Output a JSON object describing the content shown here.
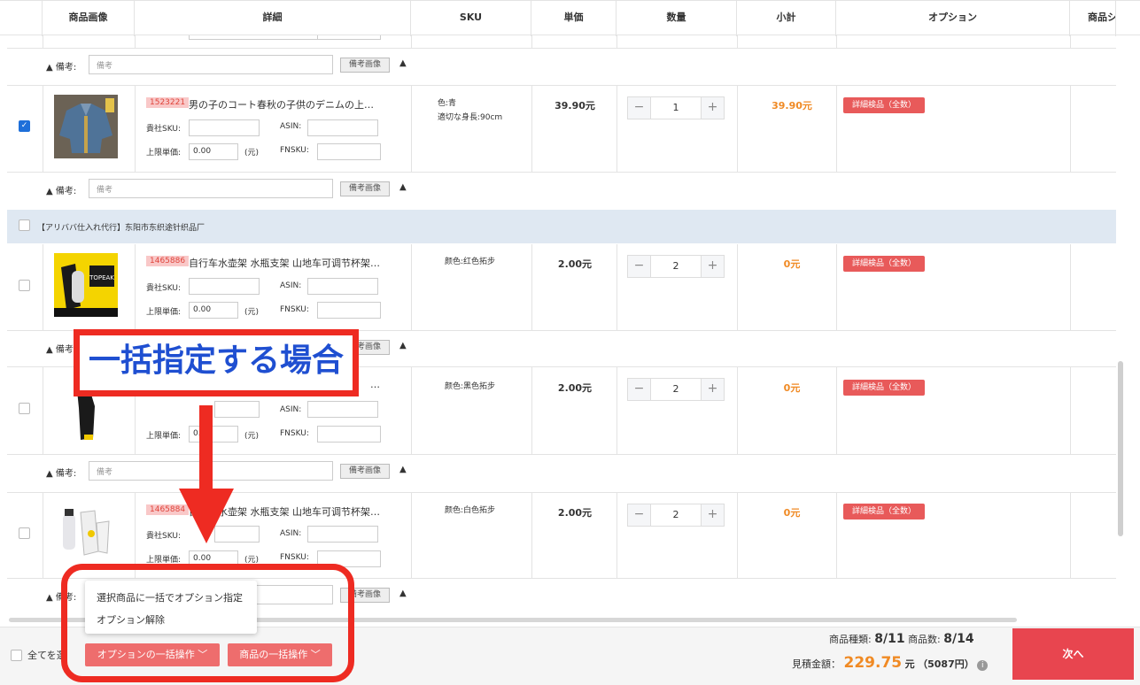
{
  "table": {
    "headers": [
      "商品画像",
      "詳細",
      "SKU",
      "単価",
      "数量",
      "小計",
      "オプション",
      "商品シ"
    ]
  },
  "labels": {
    "note": "▲ 備考:",
    "note_placeholder": "備考",
    "note_image_button": "備考画像",
    "triangle": "▲",
    "company_sku": "貴社SKU:",
    "asin": "ASIN:",
    "max_price": "上限単価:",
    "yuan_unit": "(元)",
    "fnsku": "FNSKU:",
    "minus": "−",
    "plus": "+",
    "option_button": "詳細検品（全数）"
  },
  "rows": [
    {
      "checked": true,
      "id": "1523221",
      "name": "男の子のコート春秋の子供のデニムの上…",
      "max_price": "0.00",
      "sku_lines": [
        "色:青",
        "適切な身長:90cm"
      ],
      "price": "39.90元",
      "qty": "1",
      "subtotal": "39.90元"
    },
    {
      "checked": false,
      "id": "1465886",
      "name": "自行车水壶架 水瓶支架 山地车可调节杯架…",
      "max_price": "0.00",
      "sku_lines": [
        "颜色:红色拓步"
      ],
      "price": "2.00元",
      "qty": "2",
      "subtotal": "0元"
    },
    {
      "checked": false,
      "id": "",
      "name": "…",
      "max_price": "0.",
      "sku_lines": [
        "颜色:黑色拓步"
      ],
      "price": "2.00元",
      "qty": "2",
      "subtotal": "0元"
    },
    {
      "checked": false,
      "id": "1465884",
      "name": "自行车水壶架 水瓶支架 山地车可调节杯架…",
      "max_price": "0.00",
      "sku_lines": [
        "颜色:白色拓步"
      ],
      "price": "2.00元",
      "qty": "2",
      "subtotal": "0元"
    }
  ],
  "group": {
    "title": "【アリババ仕入れ代行】东阳市东织途针织品厂"
  },
  "popup": {
    "items": [
      "選択商品に一括でオプション指定",
      "オプション解除"
    ]
  },
  "footer": {
    "select_all": "全てを選",
    "bulk_option": "オプションの一括操作",
    "bulk_product": "商品の一括操作",
    "types_label": "商品種類:",
    "types_value": "8/11",
    "count_label": "商品数:",
    "count_value": "8/14",
    "estimate_label": "見積金額：",
    "estimate_value": "229.75",
    "estimate_unit": "元",
    "estimate_jpy": "（5087円）",
    "next": "次へ"
  },
  "annotation": {
    "text": "一括指定する場合"
  },
  "colors": {
    "accent_red": "#e85a5a",
    "price_orange": "#f08a24",
    "annotation_red": "#ee2b22",
    "annotation_blue": "#1f4fd1",
    "check_blue": "#1e6fd9"
  }
}
